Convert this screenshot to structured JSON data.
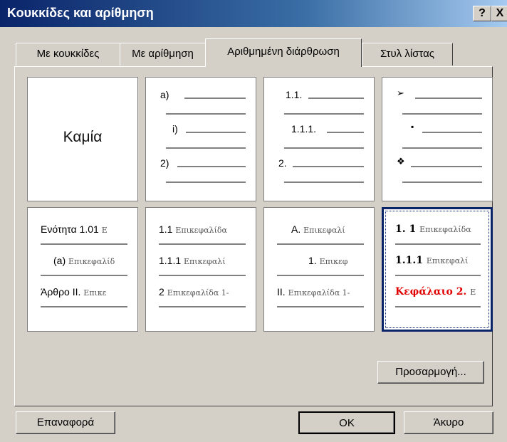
{
  "window": {
    "title": "Κουκκίδες και αρίθμηση",
    "help_label": "?",
    "close_label": "X"
  },
  "tabs": [
    {
      "label": "Με κουκκίδες"
    },
    {
      "label": "Με αρίθμηση"
    },
    {
      "label": "Αριθμημένη διάρθρωση"
    },
    {
      "label": "Στυλ λίστας"
    }
  ],
  "gallery": {
    "none_label": "Καμία",
    "cell2": {
      "l1": "a)",
      "l2": "i)",
      "l3": "2)"
    },
    "cell3": {
      "l1": "1.1.",
      "l2": "1.1.1.",
      "l3": "2."
    },
    "cell4": {
      "b1": "➢",
      "b2": "▪",
      "b3": "❖"
    },
    "cell5": {
      "l1a": "Ενότητα 1.01",
      "l1b": "Ε",
      "l2a": "(a)",
      "l2b": "Επικεφαλίδ",
      "l3a": "Άρθρο ΙΙ.",
      "l3b": "Επικε"
    },
    "cell6": {
      "l1a": "1.1",
      "l1b": "Επικεφαλίδα",
      "l2a": "1.1.1",
      "l2b": "Επικεφαλί",
      "l3a": "2",
      "l3b": "Επικεφαλίδα 1-"
    },
    "cell7": {
      "l1a": "A.",
      "l1b": "Επικεφαλί",
      "l2a": "1.",
      "l2b": "Επικεφ",
      "l3a": "II.",
      "l3b": "Επικεφαλίδα 1-"
    },
    "cell8": {
      "l1a": "1. 1",
      "l1b": "Επικεφαλίδα",
      "l2a": "1.1.1",
      "l2b": "Επικεφαλί",
      "l3a": "Κεφάλαιο 2.",
      "l3b": "Ε"
    }
  },
  "buttons": {
    "customize": "Προσαρμογή...",
    "reset": "Επαναφορά",
    "ok": "OK",
    "cancel": "Άκυρο"
  },
  "colors": {
    "title_bar": "#0a246a",
    "selected_border": "#0a246a",
    "chapter_red": "#e00000"
  }
}
